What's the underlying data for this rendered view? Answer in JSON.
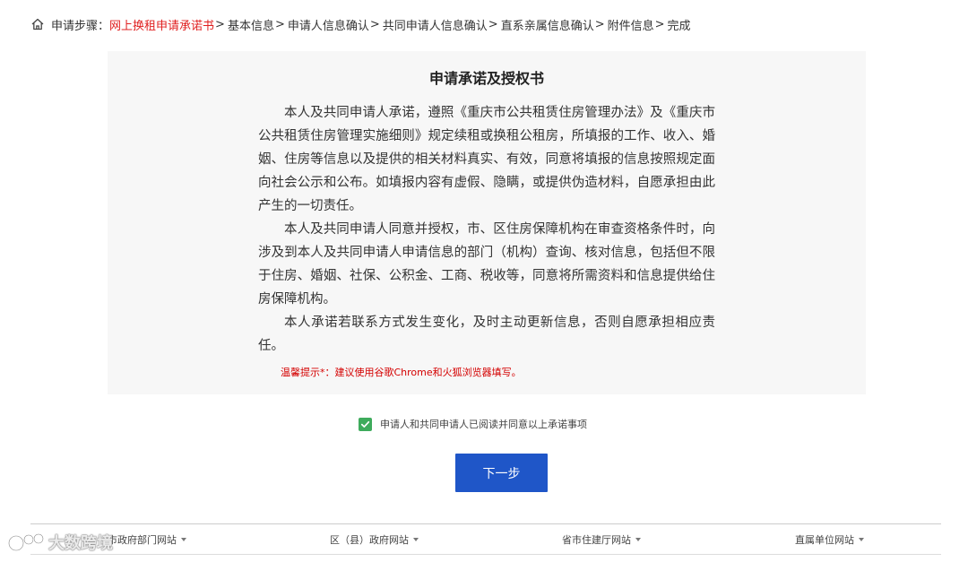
{
  "breadcrumb": {
    "prefix": "申请步骤：",
    "steps": [
      {
        "label": "网上换租申请承诺书",
        "current": true
      },
      {
        "label": "基本信息",
        "current": false
      },
      {
        "label": "申请人信息确认",
        "current": false
      },
      {
        "label": "共同申请人信息确认",
        "current": false
      },
      {
        "label": "直系亲属信息确认",
        "current": false
      },
      {
        "label": "附件信息",
        "current": false
      },
      {
        "label": "完成",
        "current": false
      }
    ],
    "separator": ">"
  },
  "panel": {
    "title": "申请承诺及授权书",
    "paragraphs": [
      "本人及共同申请人承诺，遵照《重庆市公共租赁住房管理办法》及《重庆市公共租赁住房管理实施细则》规定续租或换租公租房，所填报的工作、收入、婚姻、住房等信息以及提供的相关材料真实、有效，同意将填报的信息按照规定面向社会公示和公布。如填报内容有虚假、隐瞒，或提供伪造材料，自愿承担由此产生的一切责任。",
      "本人及共同申请人同意并授权，市、区住房保障机构在审查资格条件时，向涉及到本人及共同申请人申请信息的部门（机构）查询、核对信息，包括但不限于住房、婚姻、社保、公积金、工商、税收等，同意将所需资料和信息提供给住房保障机构。",
      "本人承诺若联系方式发生变化，及时主动更新信息，否则自愿承担相应责任。"
    ],
    "tip": "温馨提示*：建议使用谷歌Chrome和火狐浏览器填写。"
  },
  "agreement": {
    "label": "申请人和共同申请人已阅读并同意以上承诺事项",
    "checked": true,
    "check_color": "#3eab5c"
  },
  "next_button": {
    "label": "下一步",
    "color": "#1f56c8"
  },
  "footer": {
    "links": [
      {
        "label": "市政府部门网站"
      },
      {
        "label": "区（县）政府网站"
      },
      {
        "label": "省市住建厅网站"
      },
      {
        "label": "直属单位网站"
      }
    ]
  },
  "watermark": {
    "text": "大数跨境"
  },
  "colors": {
    "accent_red": "#e02020",
    "panel_bg": "#f7f7f7"
  }
}
